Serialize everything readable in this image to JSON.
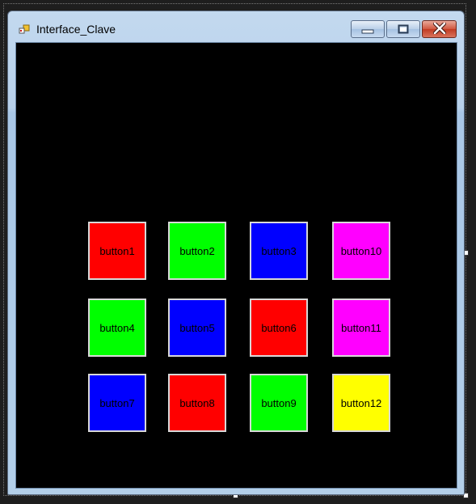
{
  "window": {
    "title": "Interface_Clave",
    "icon": "winforms-app-icon"
  },
  "caption_buttons": {
    "minimize": "minimize-icon",
    "maximize": "maximize-icon",
    "close": "close-icon"
  },
  "client": {
    "background": "#000000"
  },
  "buttons": [
    {
      "label": "button1",
      "color": "#ff0000"
    },
    {
      "label": "button2",
      "color": "#00ff00"
    },
    {
      "label": "button3",
      "color": "#0000ff"
    },
    {
      "label": "button10",
      "color": "#ff00ff"
    },
    {
      "label": "button4",
      "color": "#00ff00"
    },
    {
      "label": "button5",
      "color": "#0000ff"
    },
    {
      "label": "button6",
      "color": "#ff0000"
    },
    {
      "label": "button11",
      "color": "#ff00ff"
    },
    {
      "label": "button7",
      "color": "#0000ff"
    },
    {
      "label": "button8",
      "color": "#ff0000"
    },
    {
      "label": "button9",
      "color": "#00ff00"
    },
    {
      "label": "button12",
      "color": "#ffff00"
    }
  ]
}
